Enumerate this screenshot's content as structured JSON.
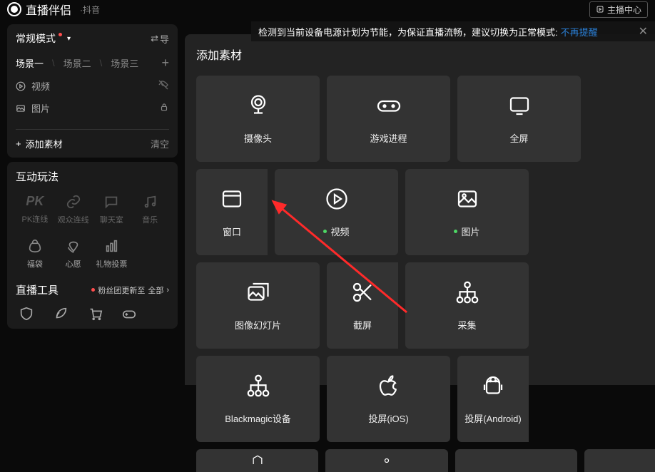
{
  "header": {
    "app_title": "直播伴侣",
    "sub_title": "·抖音",
    "stream_center": "主播中心"
  },
  "notice": {
    "text": "检测到当前设备电源计划为节能，为保证直播流畅，建议切换为正常模式:",
    "link": "不再提醒"
  },
  "left": {
    "mode_label": "常规模式",
    "import_label": "导",
    "scenes": [
      "场景一",
      "场景二",
      "场景三"
    ],
    "video_label": "视频",
    "image_label": "图片",
    "add_material": "添加素材",
    "clear": "清空"
  },
  "interact": {
    "title": "互动玩法",
    "items": [
      {
        "label": "PK连线"
      },
      {
        "label": "观众连线"
      },
      {
        "label": "聊天室"
      },
      {
        "label": "音乐"
      },
      {
        "label": "福袋"
      },
      {
        "label": "心愿"
      },
      {
        "label": "礼物投票"
      },
      {
        "label": ""
      }
    ],
    "tools_title": "直播工具",
    "fans_update": "粉丝团更新至",
    "all_label": "全部"
  },
  "modal": {
    "title": "添加素材",
    "sources": [
      {
        "label": "摄像头",
        "dot": false
      },
      {
        "label": "游戏进程",
        "dot": false
      },
      {
        "label": "全屏",
        "dot": false
      },
      {
        "label": "窗口",
        "dot": false
      },
      {
        "label": "视频",
        "dot": true
      },
      {
        "label": "图片",
        "dot": true
      },
      {
        "label": "图像幻灯片",
        "dot": false
      },
      {
        "label": "截屏",
        "dot": false
      },
      {
        "label": "采集",
        "dot": false
      },
      {
        "label": "Blackmagic设备",
        "dot": false
      },
      {
        "label": "投屏(iOS)",
        "dot": false
      },
      {
        "label": "投屏(Android)",
        "dot": false
      }
    ]
  }
}
